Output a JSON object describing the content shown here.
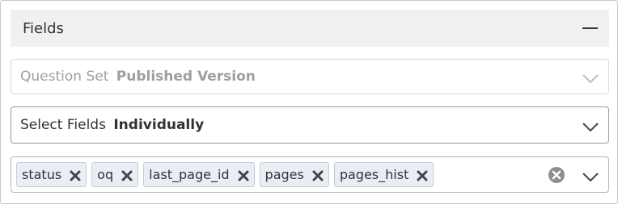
{
  "panel": {
    "title": "Fields"
  },
  "question_set": {
    "label": "Question Set",
    "value": "Published Version"
  },
  "select_fields": {
    "label": "Select Fields",
    "value": "Individually"
  },
  "selected_fields": [
    "status",
    "oq",
    "last_page_id",
    "pages",
    "pages_hist"
  ],
  "icons": {
    "collapse": "minus-icon",
    "dropdown": "chevron-down-icon",
    "remove": "close-icon",
    "clear": "clear-circle-icon"
  },
  "colors": {
    "chip_bg": "#e9edf6",
    "header_bg": "#f0f0f0"
  }
}
